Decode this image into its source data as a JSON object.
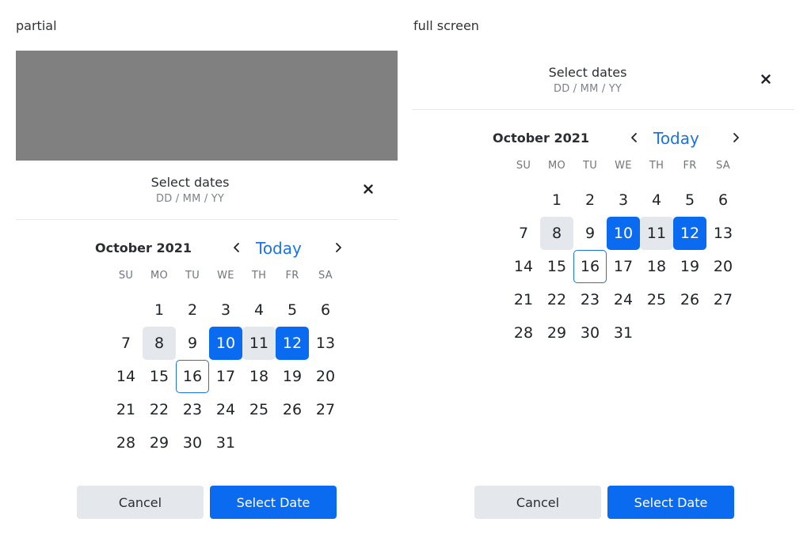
{
  "colors": {
    "accent": "#0b6bf0",
    "link": "#1a73e8",
    "muted_day_bg": "#e4e7eb",
    "backdrop": "#808080"
  },
  "labels": {
    "partial": "partial",
    "full": "full screen"
  },
  "picker": {
    "title": "Select dates",
    "subtitle": "DD / MM / YY",
    "close_icon": "close-icon",
    "month_label": "October 2021",
    "prev_icon": "chevron-left-icon",
    "next_icon": "chevron-right-icon",
    "today_label": "Today",
    "weekdays": [
      "SU",
      "MO",
      "TU",
      "WE",
      "TH",
      "FR",
      "SA"
    ],
    "cancel_label": "Cancel",
    "select_label": "Select Date"
  },
  "calendar": {
    "leading_blanks": 1,
    "days": [
      {
        "n": "1",
        "state": ""
      },
      {
        "n": "2",
        "state": ""
      },
      {
        "n": "3",
        "state": ""
      },
      {
        "n": "4",
        "state": ""
      },
      {
        "n": "5",
        "state": ""
      },
      {
        "n": "6",
        "state": ""
      },
      {
        "n": "7",
        "state": ""
      },
      {
        "n": "8",
        "state": "muted"
      },
      {
        "n": "9",
        "state": ""
      },
      {
        "n": "10",
        "state": "selected"
      },
      {
        "n": "11",
        "state": "muted"
      },
      {
        "n": "12",
        "state": "selected"
      },
      {
        "n": "13",
        "state": ""
      },
      {
        "n": "14",
        "state": ""
      },
      {
        "n": "15",
        "state": ""
      },
      {
        "n": "16",
        "state": "today"
      },
      {
        "n": "17",
        "state": ""
      },
      {
        "n": "18",
        "state": ""
      },
      {
        "n": "19",
        "state": ""
      },
      {
        "n": "20",
        "state": ""
      },
      {
        "n": "21",
        "state": ""
      },
      {
        "n": "22",
        "state": ""
      },
      {
        "n": "23",
        "state": ""
      },
      {
        "n": "24",
        "state": ""
      },
      {
        "n": "25",
        "state": ""
      },
      {
        "n": "26",
        "state": ""
      },
      {
        "n": "27",
        "state": ""
      },
      {
        "n": "28",
        "state": ""
      },
      {
        "n": "29",
        "state": ""
      },
      {
        "n": "30",
        "state": ""
      },
      {
        "n": "31",
        "state": ""
      }
    ]
  }
}
